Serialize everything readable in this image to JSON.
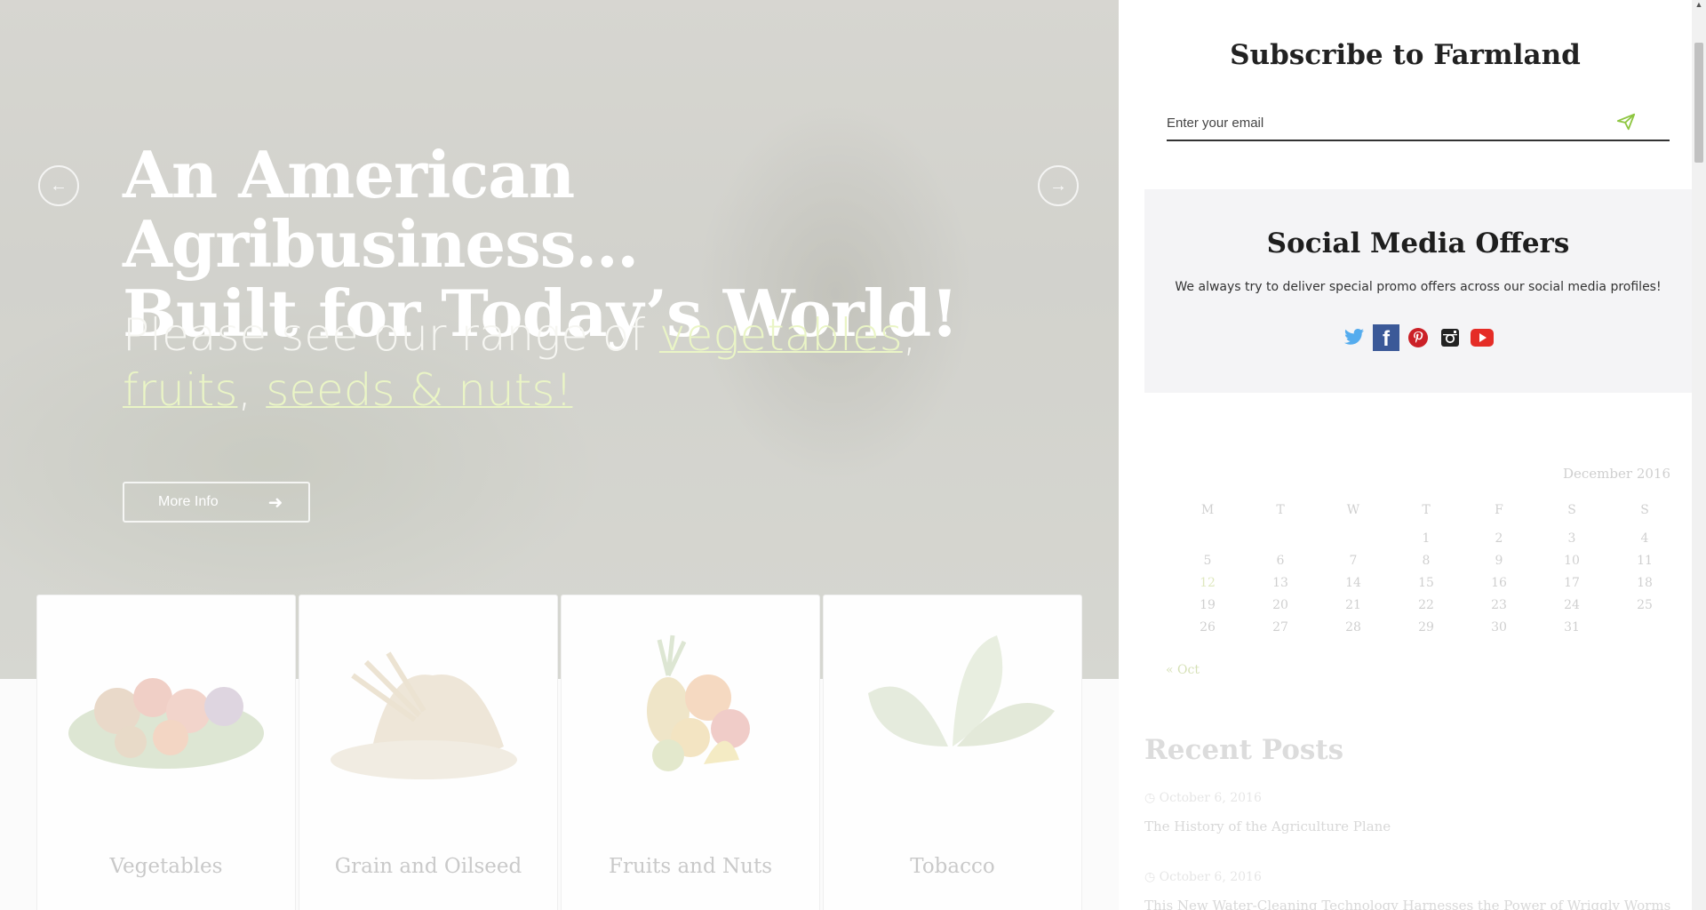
{
  "hero": {
    "title_line1": "An American Agribusiness…",
    "title_line2": "Built for Today’s World!",
    "sub_prefix": "Please see our range of ",
    "link_vegetables": "vegetables",
    "comma1": ",",
    "link_fruits": "fruits",
    "comma2": ", ",
    "link_seeds": "seeds & nuts!",
    "button_label": "More Info",
    "prev_icon": "arrow-left-icon",
    "next_icon": "arrow-right-icon"
  },
  "categories": [
    {
      "label": "Vegetables",
      "icon": "vegetables-image"
    },
    {
      "label": "Grain and Oilseed",
      "icon": "grain-image"
    },
    {
      "label": "Fruits and Nuts",
      "icon": "fruits-image"
    },
    {
      "label": "Tobacco",
      "icon": "tobacco-image"
    }
  ],
  "sidebar": {
    "subscribe_title": "Subscribe to Farmland",
    "email_placeholder": "Enter your email",
    "social_title": "Social Media Offers",
    "social_text": "We always try to deliver special promo offers across our social media profiles!",
    "social_icons": [
      "twitter-icon",
      "facebook-icon",
      "pinterest-icon",
      "instagram-icon",
      "youtube-icon"
    ],
    "calendar": {
      "caption": "December 2016",
      "weekdays": [
        "M",
        "T",
        "W",
        "T",
        "F",
        "S",
        "S"
      ],
      "weeks": [
        [
          "",
          "",
          "",
          "1",
          "2",
          "3",
          "4"
        ],
        [
          "5",
          "6",
          "7",
          "8",
          "9",
          "10",
          "11"
        ],
        [
          "12",
          "13",
          "14",
          "15",
          "16",
          "17",
          "18"
        ],
        [
          "19",
          "20",
          "21",
          "22",
          "23",
          "24",
          "25"
        ],
        [
          "26",
          "27",
          "28",
          "29",
          "30",
          "31",
          ""
        ]
      ],
      "today": "12",
      "prev_link": "« Oct"
    },
    "recent_posts_title": "Recent Posts",
    "posts": [
      {
        "date": "October 6, 2016",
        "title": "The History of the Agriculture Plane"
      },
      {
        "date": "October 6, 2016",
        "title": "This New Water-Cleaning Technology Harnesses the Power of Wriggly Worms"
      }
    ]
  },
  "colors": {
    "accent_green": "#8ec641",
    "link_highlight": "#eaf5c6",
    "twitter": "#55acee",
    "facebook": "#3b5998",
    "pinterest": "#cb2027",
    "instagram": "#222222",
    "youtube": "#e52d27"
  }
}
